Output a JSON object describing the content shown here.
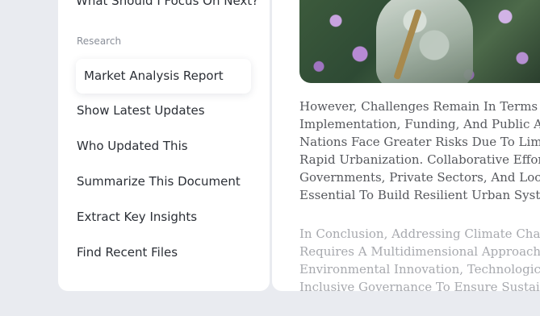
{
  "sidebar": {
    "previous_item": "What Should I Focus On Next?",
    "section_label": "Research",
    "items": [
      {
        "label": "Market Analysis Report",
        "active": true
      },
      {
        "label": "Show Latest Updates",
        "active": false
      },
      {
        "label": "Who Updated This",
        "active": false
      },
      {
        "label": "Summarize This Document",
        "active": false
      },
      {
        "label": "Extract Key Insights",
        "active": false
      },
      {
        "label": "Find Recent Files",
        "active": false
      }
    ]
  },
  "document": {
    "image_icon": "astronaut-image",
    "paragraph1": [
      "However, Challenges Remain In Terms Of",
      "Implementation, Funding, And Public Awar",
      "Nations Face Greater Risks Due To Limite",
      "Rapid Urbanization. Collaborative Efforts",
      "Governments, Private Sectors, And Local",
      "Essential To Build Resilient Urban System"
    ],
    "paragraph2": [
      "In Conclusion, Addressing Climate Chang",
      "Requires A Multidimensional Approach T",
      "Environmental Innovation, Technological",
      "Inclusive Governance To Ensure Sustain"
    ]
  },
  "colors": {
    "background": "#e9ebf0",
    "panel": "#ffffff",
    "text_primary": "#2b2f36",
    "text_muted": "#8a8f99"
  }
}
